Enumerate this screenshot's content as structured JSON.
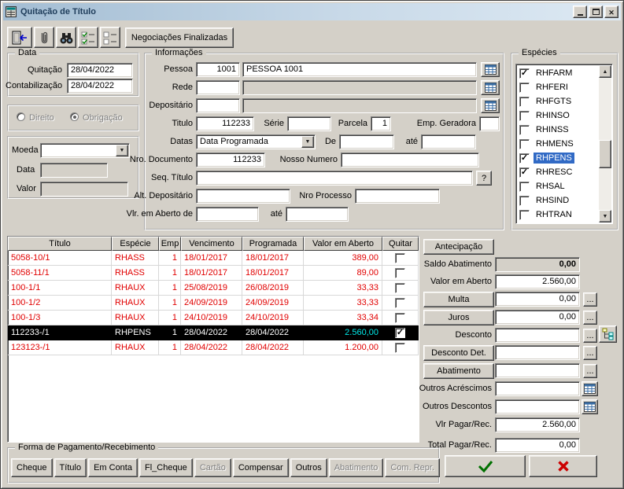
{
  "colors": {
    "dialog_bg": "#d4d0c8",
    "titlebar_start": "#a3bdd3",
    "titlebar_end": "#dde9f3",
    "selection_blue": "#316ac5",
    "grid_overdue_red": "#e10000",
    "selected_row_bg": "#000000",
    "selected_value_cyan": "#00e7e7",
    "confirm_green": "#007000",
    "cancel_red": "#cc0000"
  },
  "window": {
    "title": "Quitação de Título"
  },
  "toolbar": {
    "negotiations_finished": "Negociações Finalizadas"
  },
  "data_group": {
    "title": "Data",
    "quitacao_label": "Quitação",
    "quitacao_value": "28/04/2022",
    "contabilizacao_label": "Contabilização",
    "contabilizacao_value": "28/04/2022"
  },
  "tipo_group": {
    "direito": "Direito",
    "obrigacao": "Obrigação"
  },
  "moeda_group": {
    "moeda_label": "Moeda",
    "moeda_value": "",
    "data_label": "Data",
    "data_value": "",
    "valor_label": "Valor",
    "valor_value": ""
  },
  "informacoes": {
    "title": "Informações",
    "pessoa_label": "Pessoa",
    "pessoa_code": "1001",
    "pessoa_name": "PESSOA 1001",
    "rede_label": "Rede",
    "rede_code": "",
    "rede_name": "",
    "depositario_label": "Depositário",
    "depositario_code": "",
    "depositario_name": "",
    "titulo_label": "Titulo",
    "titulo_value": "112233",
    "serie_label": "Série",
    "serie_value": "",
    "parcela_label": "Parcela",
    "parcela_value": "1",
    "emp_geradora_label": "Emp. Geradora",
    "emp_geradora_value": "",
    "datas_label": "Datas",
    "datas_value": "Data Programada",
    "de_label": "De",
    "de_value": "",
    "ate_label": "até",
    "ate_value": "",
    "nro_documento_label": "Nro. Documento",
    "nro_documento_value": "112233",
    "nosso_numero_label": "Nosso Numero",
    "nosso_numero_value": "",
    "seq_titulo_label": "Seq. Título",
    "seq_titulo_value": "",
    "help_button": "?",
    "alt_depositario_label": "Alt. Depositário",
    "alt_depositario_value": "",
    "nro_processo_label": "Nro Processo",
    "nro_processo_value": "",
    "vlr_aberto_de_label": "Vlr. em Aberto de",
    "vlr_aberto_de_value": "",
    "vlr_aberto_ate_label": "até",
    "vlr_aberto_ate_value": ""
  },
  "especies": {
    "title": "Espécies",
    "items": [
      {
        "label": "RHFARM",
        "checked": true,
        "selected": false
      },
      {
        "label": "RHFERI",
        "checked": false,
        "selected": false
      },
      {
        "label": "RHFGTS",
        "checked": false,
        "selected": false
      },
      {
        "label": "RHINSO",
        "checked": false,
        "selected": false
      },
      {
        "label": "RHINSS",
        "checked": false,
        "selected": false
      },
      {
        "label": "RHMENS",
        "checked": false,
        "selected": false
      },
      {
        "label": "RHPENS",
        "checked": true,
        "selected": true
      },
      {
        "label": "RHRESC",
        "checked": true,
        "selected": false
      },
      {
        "label": "RHSAL",
        "checked": false,
        "selected": false
      },
      {
        "label": "RHSIND",
        "checked": false,
        "selected": false
      },
      {
        "label": "RHTRAN",
        "checked": false,
        "selected": false
      }
    ]
  },
  "grid": {
    "columns": [
      "Título",
      "Espécie",
      "Emp",
      "Vencimento",
      "Programada",
      "Valor em Aberto",
      "Quitar"
    ],
    "rows": [
      {
        "titulo": "5058-10/1",
        "especie": "RHASS",
        "emp": "1",
        "vencimento": "18/01/2017",
        "programada": "18/01/2017",
        "valor": "389,00",
        "quitar": false,
        "selected": false
      },
      {
        "titulo": "5058-11/1",
        "especie": "RHASS",
        "emp": "1",
        "vencimento": "18/01/2017",
        "programada": "18/01/2017",
        "valor": "89,00",
        "quitar": false,
        "selected": false
      },
      {
        "titulo": "100-1/1",
        "especie": "RHAUX",
        "emp": "1",
        "vencimento": "25/08/2019",
        "programada": "26/08/2019",
        "valor": "33,33",
        "quitar": false,
        "selected": false
      },
      {
        "titulo": "100-1/2",
        "especie": "RHAUX",
        "emp": "1",
        "vencimento": "24/09/2019",
        "programada": "24/09/2019",
        "valor": "33,33",
        "quitar": false,
        "selected": false
      },
      {
        "titulo": "100-1/3",
        "especie": "RHAUX",
        "emp": "1",
        "vencimento": "24/10/2019",
        "programada": "24/10/2019",
        "valor": "33,34",
        "quitar": false,
        "selected": false
      },
      {
        "titulo": "112233-/1",
        "especie": "RHPENS",
        "emp": "1",
        "vencimento": "28/04/2022",
        "programada": "28/04/2022",
        "valor": "2.560,00",
        "quitar": true,
        "selected": true
      },
      {
        "titulo": "123123-/1",
        "especie": "RHAUX",
        "emp": "1",
        "vencimento": "28/04/2022",
        "programada": "28/04/2022",
        "valor": "1.200,00",
        "quitar": false,
        "selected": false
      }
    ]
  },
  "totals": {
    "antecipacao_button": "Antecipação",
    "saldo_abatimento_label": "Saldo Abatimento",
    "saldo_abatimento_value": "0,00",
    "valor_em_aberto_label": "Valor em Aberto",
    "valor_em_aberto_value": "2.560,00",
    "multa_button": "Multa",
    "multa_value": "0,00",
    "juros_button": "Juros",
    "juros_value": "0,00",
    "desconto_label": "Desconto",
    "desconto_value": "",
    "desconto_det_button": "Desconto Det.",
    "desconto_det_value": "",
    "abatimento_button": "Abatimento",
    "abatimento_value": "",
    "outros_acrescimos_label": "Outros Acréscimos",
    "outros_acrescimos_value": "",
    "outros_descontos_label": "Outros Descontos",
    "outros_descontos_value": "",
    "vlr_pagar_label": "Vlr Pagar/Rec.",
    "vlr_pagar_value": "2.560,00",
    "total_pagar_label": "Total Pagar/Rec.",
    "total_pagar_value": "0,00",
    "ellipsis": "..."
  },
  "payment": {
    "title": "Forma de Pagamento/Recebimento",
    "buttons": [
      {
        "label": "Cheque",
        "enabled": true
      },
      {
        "label": "Título",
        "enabled": true
      },
      {
        "label": "Em Conta",
        "enabled": true
      },
      {
        "label": "Fl_Cheque",
        "enabled": true
      },
      {
        "label": "Cartão",
        "enabled": false
      },
      {
        "label": "Compensar",
        "enabled": true
      },
      {
        "label": "Outros",
        "enabled": true
      },
      {
        "label": "Abatimento",
        "enabled": false
      },
      {
        "label": "Com. Repr.",
        "enabled": false
      }
    ]
  }
}
